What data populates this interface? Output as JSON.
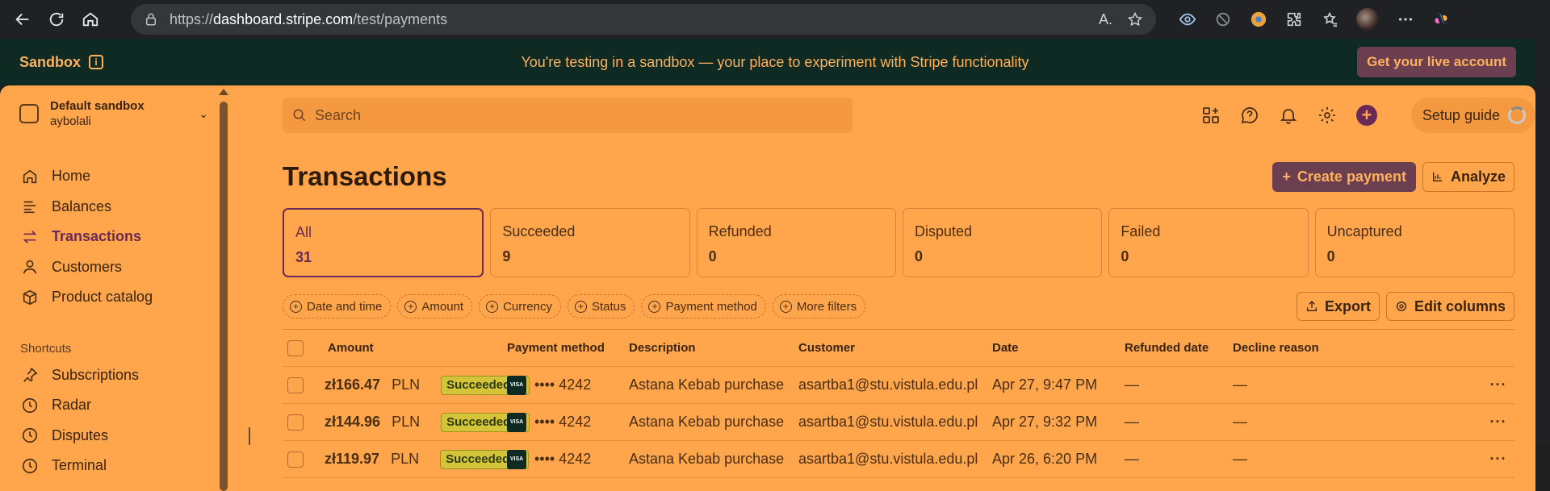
{
  "browser": {
    "url_prefix": "https://",
    "url_host": "dashboard.stripe.com",
    "url_path": "/test/payments"
  },
  "banner": {
    "label": "Sandbox",
    "message": "You're testing in a sandbox — your place to experiment with Stripe functionality",
    "live_button": "Get your live account"
  },
  "account": {
    "name": "Default sandbox",
    "user": "aybolali"
  },
  "sidebar": {
    "items": [
      {
        "label": "Home",
        "icon": "home-icon"
      },
      {
        "label": "Balances",
        "icon": "balances-icon"
      },
      {
        "label": "Transactions",
        "icon": "transactions-icon",
        "active": true
      },
      {
        "label": "Customers",
        "icon": "customers-icon"
      },
      {
        "label": "Product catalog",
        "icon": "product-catalog-icon"
      }
    ],
    "shortcuts_title": "Shortcuts",
    "shortcuts": [
      {
        "label": "Subscriptions",
        "icon": "pin-icon"
      },
      {
        "label": "Radar",
        "icon": "clock-icon"
      },
      {
        "label": "Disputes",
        "icon": "clock-icon"
      },
      {
        "label": "Terminal",
        "icon": "clock-icon"
      }
    ]
  },
  "search": {
    "placeholder": "Search"
  },
  "header": {
    "setup_guide": "Setup guide"
  },
  "page": {
    "title": "Transactions",
    "create_payment": "Create payment",
    "analyze": "Analyze",
    "export": "Export",
    "edit_columns": "Edit columns"
  },
  "status_tabs": [
    {
      "label": "All",
      "count": "31",
      "active": true
    },
    {
      "label": "Succeeded",
      "count": "9"
    },
    {
      "label": "Refunded",
      "count": "0"
    },
    {
      "label": "Disputed",
      "count": "0"
    },
    {
      "label": "Failed",
      "count": "0"
    },
    {
      "label": "Uncaptured",
      "count": "0"
    }
  ],
  "filters": [
    "Date and time",
    "Amount",
    "Currency",
    "Status",
    "Payment method",
    "More filters"
  ],
  "table": {
    "columns": [
      "Amount",
      "Payment method",
      "Description",
      "Customer",
      "Date",
      "Refunded date",
      "Decline reason"
    ],
    "rows": [
      {
        "amount": "zł166.47",
        "currency": "PLN",
        "status": "Succeeded",
        "card": "•••• 4242",
        "description": "Astana Kebab purchase",
        "customer": "asartba1@stu.vistula.edu.pl",
        "date": "Apr 27, 9:47 PM",
        "refunded": "—",
        "decline": "—"
      },
      {
        "amount": "zł144.96",
        "currency": "PLN",
        "status": "Succeeded",
        "card": "•••• 4242",
        "description": "Astana Kebab purchase",
        "customer": "asartba1@stu.vistula.edu.pl",
        "date": "Apr 27, 9:32 PM",
        "refunded": "—",
        "decline": "—"
      },
      {
        "amount": "zł119.97",
        "currency": "PLN",
        "status": "Succeeded",
        "card": "•••• 4242",
        "description": "Astana Kebab purchase",
        "customer": "asartba1@stu.vistula.edu.pl",
        "date": "Apr 26, 6:20 PM",
        "refunded": "—",
        "decline": "—"
      }
    ],
    "card_brand": "VISA",
    "more": "···"
  },
  "colors": {
    "app_bg": "#ffa64d",
    "banner_bg": "#0e2a23",
    "accent": "#6a2a55",
    "badge_bg": "#d4c43a"
  }
}
